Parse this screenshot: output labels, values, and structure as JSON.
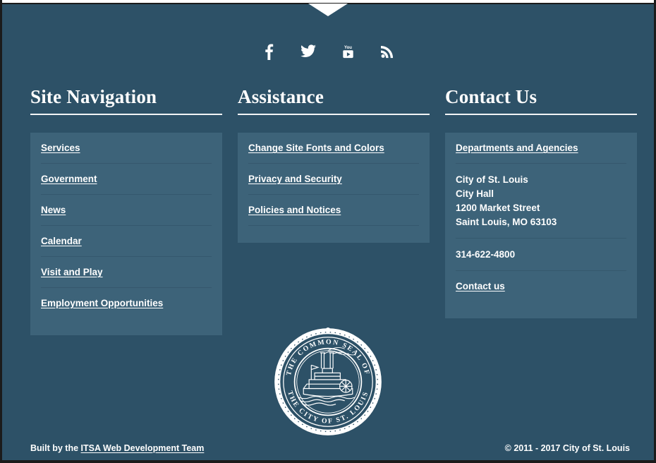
{
  "theme": {
    "background": "#2d5167",
    "panel_background": "#3d6379",
    "text_color": "#ffffff",
    "rule_color": "#35586d",
    "frame_color": "#1b1b1b",
    "notch_color": "#ffffff"
  },
  "social": {
    "items": [
      {
        "name": "facebook-icon",
        "label": "Facebook"
      },
      {
        "name": "twitter-icon",
        "label": "Twitter"
      },
      {
        "name": "youtube-icon",
        "label": "YouTube"
      },
      {
        "name": "rss-icon",
        "label": "RSS Feed"
      }
    ]
  },
  "columns": {
    "site_navigation": {
      "heading": "Site Navigation",
      "links": [
        "Services",
        "Government",
        "News",
        "Calendar",
        "Visit and Play",
        "Employment Opportunities"
      ]
    },
    "assistance": {
      "heading": "Assistance",
      "links": [
        "Change Site Fonts and Colors",
        "Privacy and Security",
        "Policies and Notices"
      ]
    },
    "contact_us": {
      "heading": "Contact Us",
      "departments_link": "Departments and Agencies",
      "address": [
        "City of St. Louis",
        "City Hall",
        "1200 Market Street",
        "Saint Louis, MO 63103"
      ],
      "phone": "314-622-4800",
      "contact_link": "Contact us"
    }
  },
  "seal": {
    "name": "city-of-st-louis-seal",
    "top_text": "THE COMMON SEAL OF",
    "bottom_text": "THE CITY OF ST. LOUIS",
    "emblem": "steamboat"
  },
  "footer": {
    "built_by_prefix": "Built by the ",
    "built_by_link": "ITSA Web Development Team",
    "copyright": "© 2011 - 2017 City of St. Louis"
  }
}
